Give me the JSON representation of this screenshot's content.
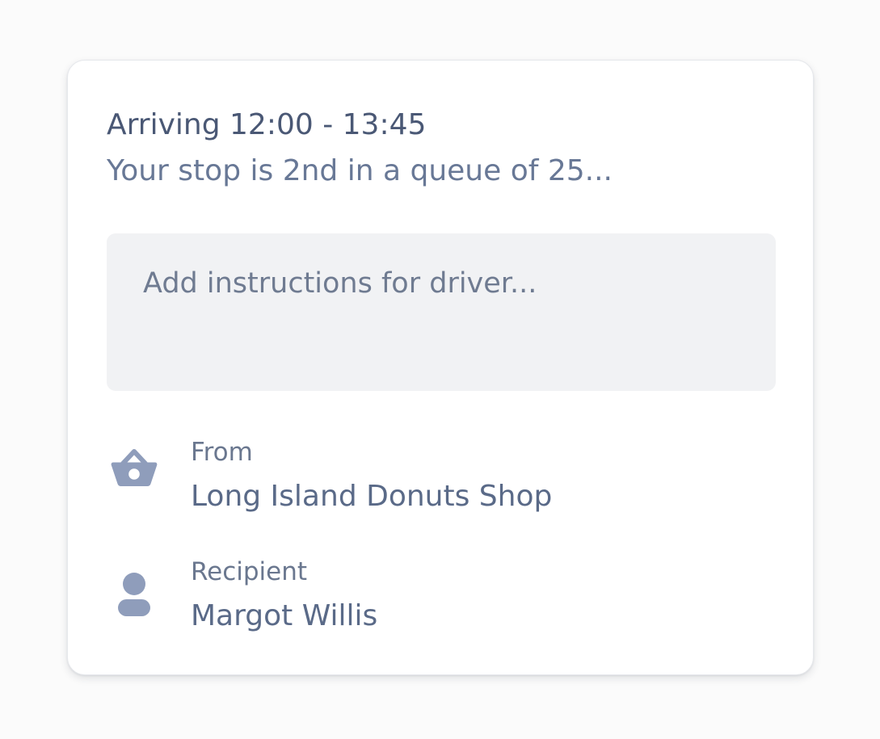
{
  "delivery": {
    "arrival_title": "Arriving 12:00 - 13:45",
    "queue_text": "Your stop is 2nd in a queue of 25..."
  },
  "instructions": {
    "placeholder": "Add instructions for driver...",
    "value": ""
  },
  "details": {
    "from": {
      "label": "From",
      "value": "Long Island Donuts Shop",
      "icon": "basket-icon"
    },
    "recipient": {
      "label": "Recipient",
      "value": "Margot Willis",
      "icon": "person-icon"
    }
  },
  "colors": {
    "icon": "#8f9dbb",
    "field_background": "#f1f2f4",
    "title_text": "#4a5875",
    "body_text": "#687896"
  }
}
